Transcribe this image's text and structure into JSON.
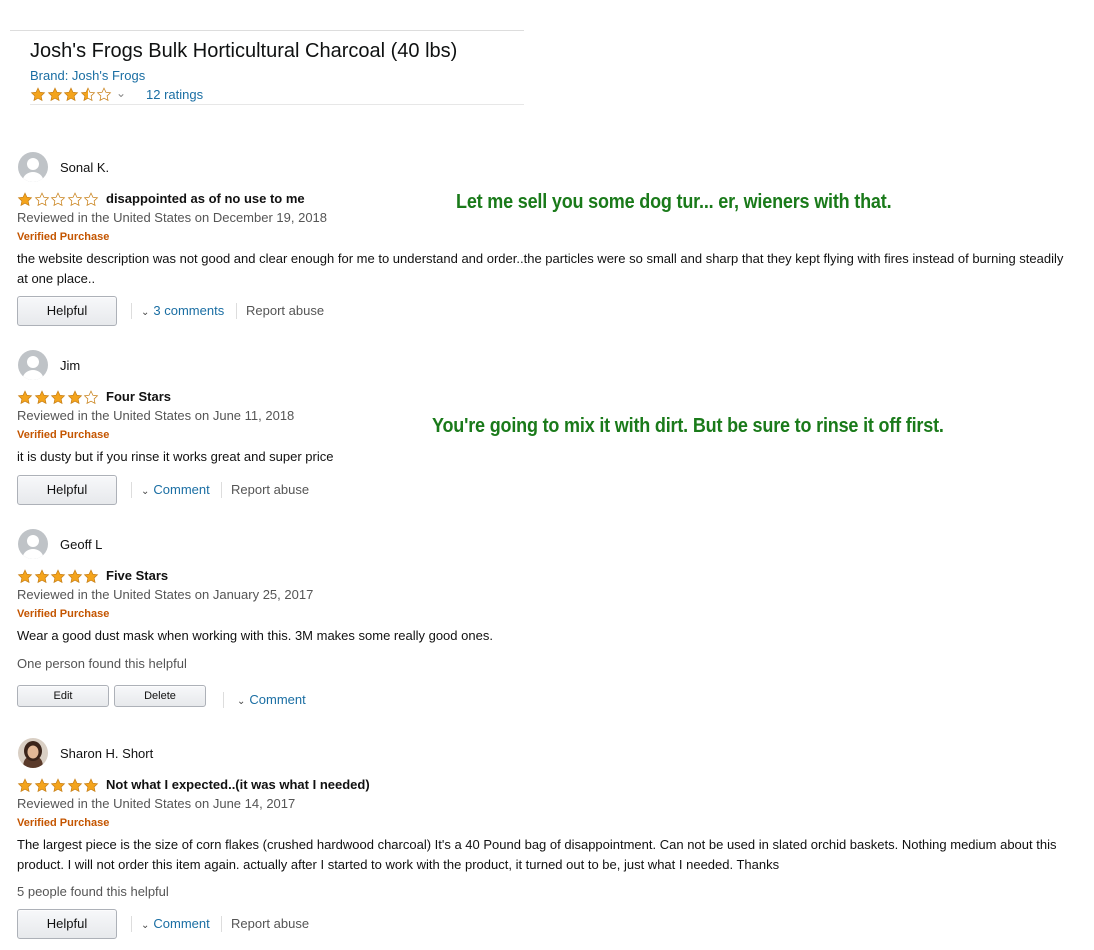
{
  "product": {
    "title": "Josh's Frogs Bulk Horticultural Charcoal (40 lbs)",
    "brand": "Brand: Josh's Frogs",
    "ratings_link": "12 ratings",
    "rating": 3.5,
    "chevron": "⌄"
  },
  "colors": {
    "star_filled": "#f4a41c",
    "star_empty": "#ffffff",
    "link": "#1a6ea3",
    "verified": "#c45500",
    "annotation": "#1a7a1a"
  },
  "annotations": [
    "Let me sell you some dog tur... er, wieners with that.",
    "You're going to mix it with dirt.  But be sure to rinse it off first."
  ],
  "reviews": [
    {
      "name": "Sonal K.",
      "avatar": "default-avatar-icon",
      "stars": 1,
      "title": "disappointed as of no use to me",
      "date": "Reviewed in the United States on December 19, 2018",
      "verified": "Verified Purchase",
      "body": "the website description was not good and clear enough for me to understand and order..the particles were so small and sharp that they kept flying with fires instead of burning steadily at one place..",
      "helpful_button": "Helpful",
      "comments_link": "3 comments",
      "report_link": "Report abuse"
    },
    {
      "name": "Jim",
      "avatar": "default-avatar-icon",
      "stars": 4,
      "title": "Four Stars",
      "date": "Reviewed in the United States on June 11, 2018",
      "verified": "Verified Purchase",
      "body": "it is dusty but if you rinse it works great and super price",
      "helpful_button": "Helpful",
      "comments_link": "Comment",
      "report_link": "Report abuse"
    },
    {
      "name": "Geoff L",
      "avatar": "default-avatar-icon",
      "stars": 5,
      "title": "Five Stars",
      "date": "Reviewed in the United States on January 25, 2017",
      "verified": "Verified Purchase",
      "body": "Wear a good dust mask when working with this. 3M makes some really good ones.",
      "helpful_count": "One person found this helpful",
      "edit_button": "Edit",
      "delete_button": "Delete",
      "comments_link": "Comment"
    },
    {
      "name": "Sharon H. Short",
      "avatar": "user-photo-avatar",
      "stars": 5,
      "title": "Not what I expected..(it was what I needed)",
      "date": "Reviewed in the United States on June 14, 2017",
      "verified": "Verified Purchase",
      "body": "The largest piece is the size of corn flakes (crushed hardwood charcoal) It's a 40 Pound bag of disappointment. Can not be used in slated orchid baskets. Nothing medium about this product. I will not order this item again. actually after I started to work with the product, it turned out to be, just what I needed. Thanks",
      "helpful_count": "5 people found this helpful",
      "helpful_button": "Helpful",
      "comments_link": "Comment",
      "report_link": "Report abuse"
    }
  ]
}
